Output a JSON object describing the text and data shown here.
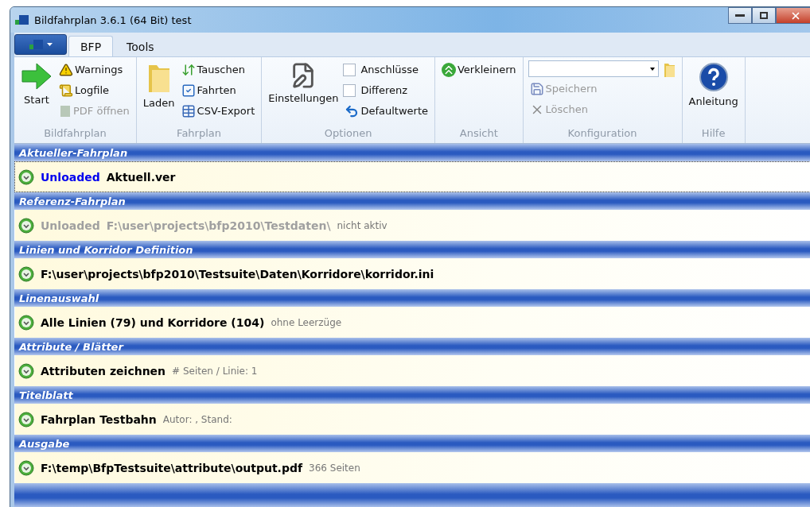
{
  "window": {
    "title": "Bildfahrplan 3.6.1 (64 Bit) test"
  },
  "tabs": [
    {
      "label": "BFP",
      "selected": true
    },
    {
      "label": "Tools",
      "selected": false
    }
  ],
  "ribbon": {
    "groups": [
      {
        "label": "Bildfahrplan",
        "columns": [
          [
            {
              "kind": "large",
              "label": "Start",
              "disabled": false
            }
          ],
          [
            {
              "kind": "small",
              "label": "Warnings",
              "disabled": false
            },
            {
              "kind": "small",
              "label": "Logfile",
              "disabled": false
            },
            {
              "kind": "small",
              "label": "PDF öffnen",
              "disabled": true
            }
          ]
        ]
      },
      {
        "label": "Fahrplan",
        "columns": [
          [
            {
              "kind": "large",
              "label": "Laden",
              "disabled": false
            }
          ],
          [
            {
              "kind": "small",
              "label": "Tauschen",
              "disabled": false
            },
            {
              "kind": "small",
              "label": "Fahrten",
              "disabled": false
            },
            {
              "kind": "small",
              "label": "CSV-Export",
              "disabled": false
            }
          ]
        ]
      },
      {
        "label": "Optionen",
        "columns": [
          [
            {
              "kind": "large",
              "label": "Einstellungen",
              "disabled": false
            }
          ],
          [
            {
              "kind": "checkbox",
              "label": "Anschlüsse",
              "checked": false
            },
            {
              "kind": "checkbox",
              "label": "Differenz",
              "checked": false
            },
            {
              "kind": "small",
              "label": "Defaultwerte",
              "disabled": false
            }
          ]
        ]
      },
      {
        "label": "Ansicht",
        "columns": [
          [
            {
              "kind": "small",
              "label": "Verkleinern",
              "disabled": false
            }
          ]
        ]
      },
      {
        "label": "Konfiguration",
        "columns": [
          [
            {
              "kind": "combo"
            },
            {
              "kind": "small",
              "label": "Speichern",
              "disabled": true
            },
            {
              "kind": "small",
              "label": "Löschen",
              "disabled": true
            }
          ],
          [
            {
              "kind": "icon",
              "disabled": false
            }
          ]
        ]
      },
      {
        "label": "Hilfe",
        "columns": [
          [
            {
              "kind": "large",
              "label": "Anleitung",
              "disabled": false
            }
          ]
        ]
      }
    ]
  },
  "sections": [
    {
      "title": "Aktueller-Fahrplan",
      "focused": true,
      "parts": [
        {
          "kind": "accent",
          "text": "Unloaded"
        },
        {
          "kind": "bold",
          "text": "Aktuell.ver"
        }
      ]
    },
    {
      "title": "Referenz-Fahrplan",
      "focused": false,
      "parts": [
        {
          "kind": "muted",
          "text": "Unloaded"
        },
        {
          "kind": "muted",
          "text": "F:\\user\\projects\\bfp2010\\Testdaten\\"
        },
        {
          "kind": "note",
          "text": "nicht aktiv"
        }
      ]
    },
    {
      "title": "Linien und Korridor Definition",
      "focused": false,
      "parts": [
        {
          "kind": "bold",
          "text": "F:\\user\\projects\\bfp2010\\Testsuite\\Daten\\Korridore\\korridor.ini"
        }
      ]
    },
    {
      "title": "Linenauswahl",
      "focused": false,
      "parts": [
        {
          "kind": "bold",
          "text": "Alle Linien (79) und Korridore (104)"
        },
        {
          "kind": "note",
          "text": "ohne Leerzüge"
        }
      ]
    },
    {
      "title": "Attribute / Blätter",
      "focused": false,
      "parts": [
        {
          "kind": "bold",
          "text": "Attributen zeichnen"
        },
        {
          "kind": "note",
          "text": "# Seiten / Linie: 1"
        }
      ]
    },
    {
      "title": "Titelblatt",
      "focused": false,
      "parts": [
        {
          "kind": "bold",
          "text": "Fahrplan Testbahn"
        },
        {
          "kind": "note",
          "text": "Autor: , Stand:"
        }
      ]
    },
    {
      "title": "Ausgabe",
      "focused": false,
      "parts": [
        {
          "kind": "bold",
          "text": "F:\\temp\\BfpTestsuite\\attribute\\output.pdf"
        },
        {
          "kind": "note",
          "text": "366 Seiten"
        }
      ]
    }
  ]
}
